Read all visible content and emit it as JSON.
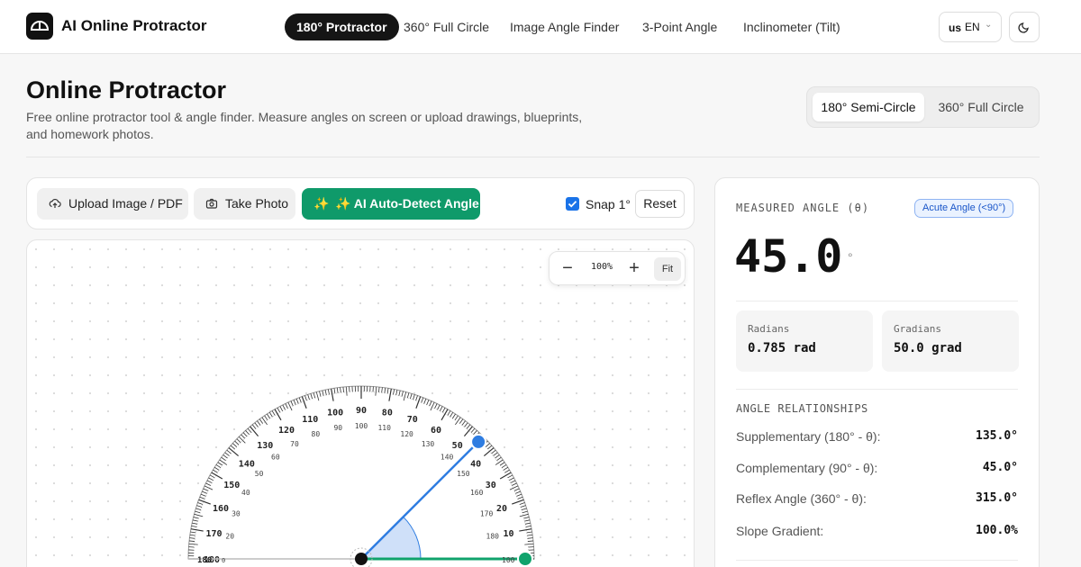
{
  "app": {
    "title": "AI Online Protractor"
  },
  "nav": {
    "items": [
      {
        "label": "180° Protractor",
        "active": true
      },
      {
        "label": "360° Full Circle",
        "active": false
      },
      {
        "label": "Image Angle Finder",
        "active": false
      },
      {
        "label": "3-Point Angle",
        "active": false
      },
      {
        "label": "Inclinometer (Tilt)",
        "active": false
      }
    ],
    "lang": {
      "flag": "us",
      "code": "EN"
    }
  },
  "header": {
    "title": "Online Protractor",
    "subtitle": "Free online protractor tool & angle finder. Measure angles on screen or upload drawings, blueprints, and homework photos.",
    "modes": [
      {
        "label": "180° Semi-Circle",
        "active": true
      },
      {
        "label": "360° Full Circle",
        "active": false
      }
    ]
  },
  "toolbar": {
    "upload_label": "Upload Image / PDF",
    "photo_label": "Take Photo",
    "ai_label": "✨ AI Auto-Detect Angle",
    "snap_label": "Snap 1°",
    "snap_checked": true,
    "reset_label": "Reset"
  },
  "canvas": {
    "zoom_label": "100%",
    "fit_label": "Fit",
    "measured_angle_deg": 45,
    "outer_scale": [
      "10",
      "20",
      "30",
      "40",
      "50",
      "60",
      "70",
      "80",
      "90",
      "100",
      "110",
      "120",
      "130",
      "140",
      "150",
      "160",
      "170",
      "180"
    ],
    "inner_scale": [
      "180",
      "170",
      "160",
      "150",
      "140",
      "130",
      "120",
      "110",
      "100",
      "90",
      "80",
      "70",
      "60",
      "50",
      "40",
      "30",
      "20",
      "10"
    ],
    "zero_label": "0",
    "arm_colors": {
      "base": "#10a36c",
      "measure": "#2f7de1",
      "arc_fill": "#cfe0f9"
    }
  },
  "panel": {
    "label": "MEASURED ANGLE (θ)",
    "badge": "Acute Angle (<90°)",
    "value": "45.0",
    "unit_symbol": "°",
    "radians_label": "Radians",
    "radians_value": "0.785 rad",
    "gradians_label": "Gradians",
    "gradians_value": "50.0 grad",
    "relationships_title": "ANGLE RELATIONSHIPS",
    "relationships": [
      {
        "label": "Supplementary (180° - θ):",
        "value": "135.0°"
      },
      {
        "label": "Complementary (90° - θ):",
        "value": "45.0°"
      },
      {
        "label": "Reflex Angle (360° - θ):",
        "value": "315.0°"
      },
      {
        "label": "Slope Gradient:",
        "value": "100.0%"
      }
    ]
  }
}
